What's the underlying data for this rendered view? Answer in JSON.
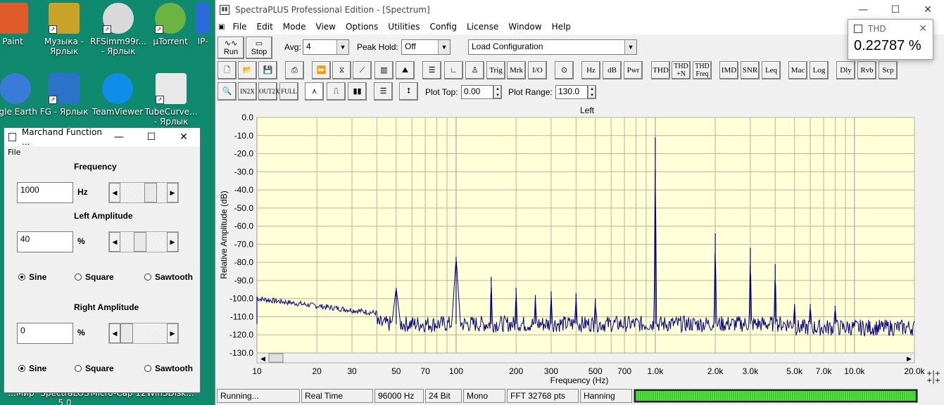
{
  "desktop": {
    "icons": [
      {
        "label": "Paint",
        "color": "#e05a2a"
      },
      {
        "label": "Музыка - Ярлык",
        "color": "#c9a227"
      },
      {
        "label": "RFSimm99r... - Ярлык",
        "color": "#d9d9d9"
      },
      {
        "label": "µTorrent",
        "color": "#6cb33f"
      },
      {
        "label": "IP-",
        "color": "#2a6ad9"
      },
      {
        "label": "ogle Earth",
        "color": "#3a7ad9"
      },
      {
        "label": "FG - Ярлык",
        "color": "#2a73c8"
      },
      {
        "label": "TeamViewer",
        "color": "#0e8ee9"
      },
      {
        "label": "TubeCurve... - Ярлык",
        "color": "#e8e8e8"
      }
    ],
    "bottom_labels": [
      "...Мир",
      "SpectraLOS 5.0",
      "Micro-Cap 12",
      "WinSDisk..."
    ]
  },
  "marchand": {
    "title": "Marchand Function ...",
    "menu": "File",
    "freq_label": "Frequency",
    "freq_value": "1000",
    "freq_unit": "Hz",
    "left_label": "Left Amplitude",
    "left_value": "40",
    "left_unit": "%",
    "right_label": "Right Amplitude",
    "right_value": "0",
    "right_unit": "%",
    "wave": [
      "Sine",
      "Square",
      "Sawtooth"
    ]
  },
  "spectra": {
    "title": "SpectraPLUS Professional Edition - [Spectrum]",
    "menu": [
      "File",
      "Edit",
      "Mode",
      "View",
      "Options",
      "Utilities",
      "Config",
      "License",
      "Window",
      "Help"
    ],
    "run": "Run",
    "stop": "Stop",
    "avg_label": "Avg:",
    "avg": "4",
    "peak_label": "Peak Hold:",
    "peak": "Off",
    "config": "Load Configuration",
    "tools": [
      "Trig",
      "Mrk",
      "I/O",
      "Hz",
      "dB",
      "Pwr",
      "THD",
      "THD +N",
      "THD Freq",
      "IMD",
      "SNR",
      "Leq",
      "Mac",
      "Log",
      "Dly",
      "Rvb",
      "Scp"
    ],
    "plot_top_label": "Plot Top:",
    "plot_top": "0.00",
    "plot_range_label": "Plot Range:",
    "plot_range": "130.0",
    "status": [
      "Running...",
      "Real Time",
      "96000 Hz",
      "24 Bit",
      "Mono",
      "FFT 32768 pts",
      "Hanning"
    ]
  },
  "thd": {
    "title": "THD",
    "value": "0.22787 %"
  },
  "chart_data": {
    "type": "line",
    "title": "Left",
    "xlabel": "Frequency (Hz)",
    "ylabel": "Relative Amplitude (dB)",
    "xscale": "log",
    "xlim": [
      10,
      20000
    ],
    "ylim": [
      -130,
      0
    ],
    "x_ticks": [
      "10",
      "20",
      "30",
      "50",
      "70",
      "100",
      "200",
      "300",
      "500",
      "700",
      "1.0k",
      "2.0k",
      "3.0k",
      "5.0k",
      "7.0k",
      "10.0k",
      "20.0k"
    ],
    "y_ticks": [
      "0.0",
      "-10.0",
      "-20.0",
      "-30.0",
      "-40.0",
      "-50.0",
      "-60.0",
      "-70.0",
      "-80.0",
      "-90.0",
      "-100.0",
      "-110.0",
      "-120.0",
      "-130.0"
    ],
    "peaks": [
      {
        "x": 10,
        "y": -99
      },
      {
        "x": 50,
        "y": -94
      },
      {
        "x": 100,
        "y": -77
      },
      {
        "x": 150,
        "y": -88
      },
      {
        "x": 200,
        "y": -94
      },
      {
        "x": 250,
        "y": -98
      },
      {
        "x": 300,
        "y": -96
      },
      {
        "x": 400,
        "y": -97
      },
      {
        "x": 500,
        "y": -100
      },
      {
        "x": 1000,
        "y": -11
      },
      {
        "x": 2000,
        "y": -64
      },
      {
        "x": 3000,
        "y": -72
      },
      {
        "x": 4000,
        "y": -81
      },
      {
        "x": 5000,
        "y": -103
      },
      {
        "x": 6000,
        "y": -103
      },
      {
        "x": 8000,
        "y": -104
      }
    ],
    "floor_db": -114,
    "line_color": "#000080",
    "bg_color": "#ffffd8",
    "grid": true
  }
}
